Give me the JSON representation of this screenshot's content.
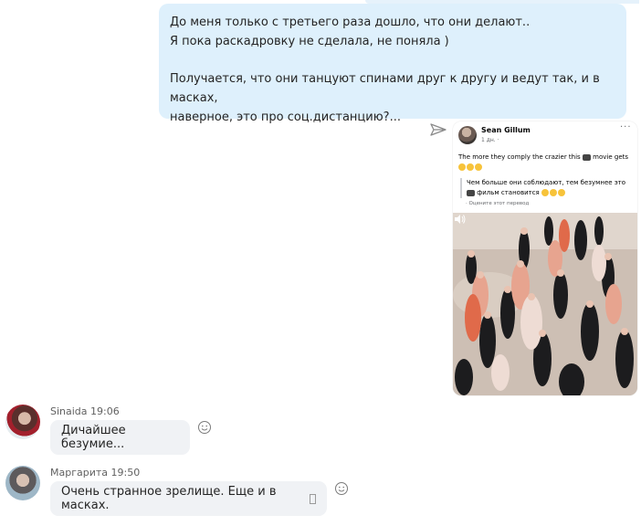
{
  "outgoing": {
    "line1": "До меня только с третьего раза дошло, что они делают..",
    "line2": "Я пока раскадровку не сделала, не поняла )",
    "line3": "Получается, что они танцуют спинами друг к другу и ведут так, и в масках,",
    "line4": "наверное, это про соц.дистанцию?..."
  },
  "shared_post": {
    "author": "Sean Gillum",
    "time": "1 дн. ·",
    "text": "The more they comply the crazier this",
    "text_end": "movie gets",
    "translation_a": "Чем больше они соблюдают, тем безумнее",
    "translation_b": "это",
    "translation_c": "фильм становится",
    "translate_link": "· Оцените этот перевод",
    "menu": "···"
  },
  "messages": [
    {
      "sender": "Sinaida",
      "time": "19:06",
      "text": "Дичайшее безумие..."
    },
    {
      "sender": "Маргарита",
      "time": "19:50",
      "text": "Очень странное зрелище. Еще и в масках."
    }
  ],
  "icons": {
    "send": "paper-plane-icon",
    "react": "smiley-icon",
    "video_sound": "speaker-icon"
  },
  "colors": {
    "outgoing_bubble": "#def0fc",
    "incoming_bubble": "#f0f2f5"
  }
}
